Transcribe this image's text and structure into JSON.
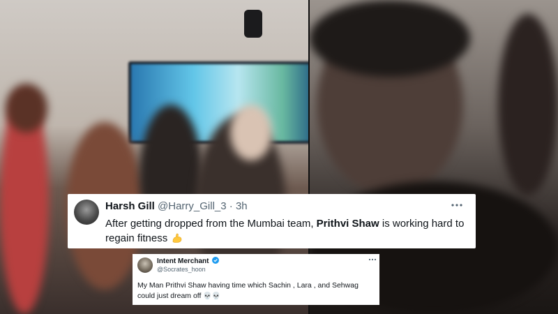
{
  "tweet_main": {
    "name": "Harsh Gill",
    "handle": "@Harry_Gill_3",
    "separator": "·",
    "time": "3h",
    "more_icon": "more-horizontal-icon",
    "text_part1": "After getting dropped from the Mumbai team, ",
    "text_bold": "Prithvi Shaw",
    "text_part2": " is working hard to regain fitness",
    "emoji": "flexed-biceps-emoji"
  },
  "tweet_small": {
    "name": "Intent Merchant",
    "handle": "@Socrates_hoon",
    "verified_icon": "verified-badge-icon",
    "more_icon": "more-horizontal-icon",
    "text": "My Man Prithvi Shaw having time which Sachin , Lara , and Sehwag could just dream off",
    "emoji": "💀💀"
  },
  "colors": {
    "card_bg": "#ffffff",
    "text_primary": "#0f1419",
    "text_secondary": "#536471",
    "verified_blue": "#1d9bf0",
    "muscle_yellow": "#ffc83d"
  }
}
